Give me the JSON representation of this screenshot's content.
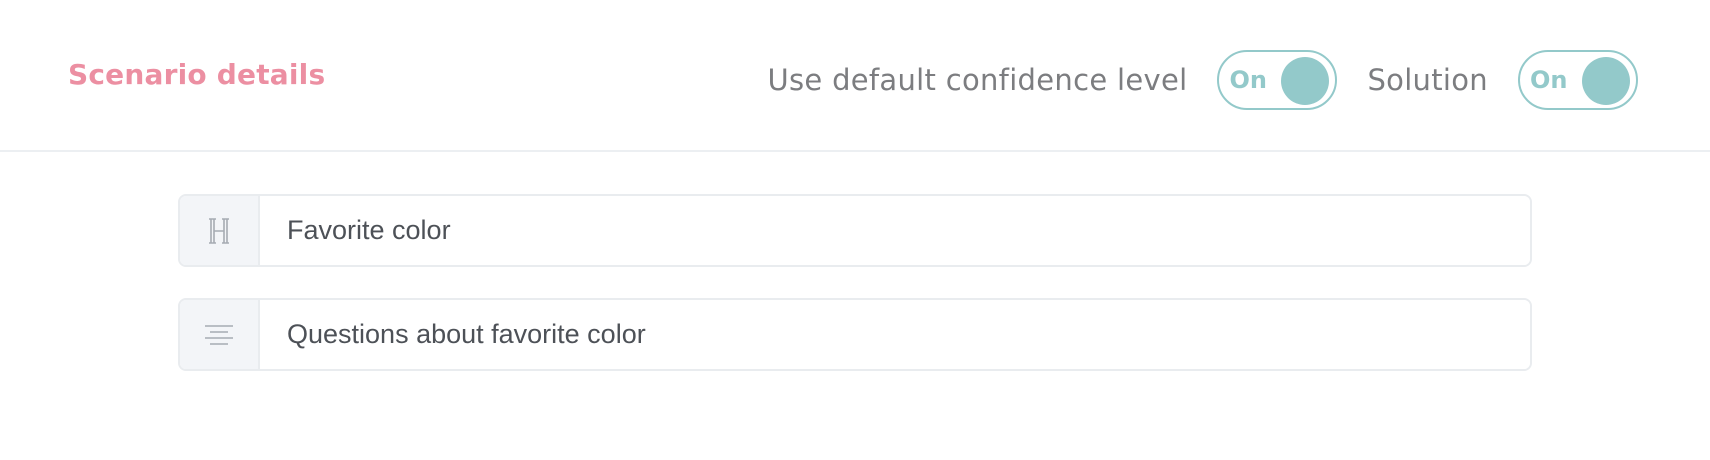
{
  "header": {
    "title": "Scenario details",
    "confidence_label": "Use default confidence level",
    "confidence_toggle": "On",
    "solution_label": "Solution",
    "solution_toggle": "On"
  },
  "fields": {
    "title": {
      "value": "Favorite color",
      "icon": "heading-icon"
    },
    "description": {
      "value": "Questions about favorite color",
      "icon": "text-align-center-icon"
    }
  },
  "colors": {
    "title": "#ec8fa2",
    "toggle_accent": "#93c9ca",
    "label": "#7c7d80",
    "input_text": "#4d5157"
  }
}
